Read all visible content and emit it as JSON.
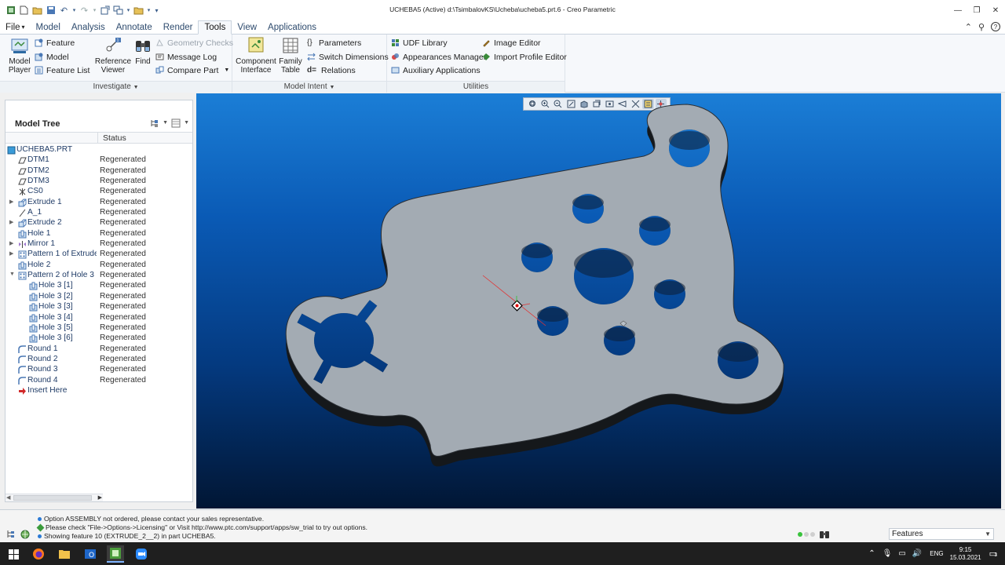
{
  "window": {
    "title": "UCHEBA5 (Active) d:\\TsimbalovKS\\Ucheba\\ucheba5.prt.6 - Creo Parametric"
  },
  "tabs": [
    {
      "label": "File",
      "id": "file"
    },
    {
      "label": "Model",
      "id": "model"
    },
    {
      "label": "Analysis",
      "id": "analysis"
    },
    {
      "label": "Annotate",
      "id": "annotate"
    },
    {
      "label": "Render",
      "id": "render"
    },
    {
      "label": "Tools",
      "id": "tools",
      "active": true
    },
    {
      "label": "View",
      "id": "view"
    },
    {
      "label": "Applications",
      "id": "applications"
    }
  ],
  "ribbon": {
    "investigate": {
      "label": "Investigate",
      "model_player": "Model\nPlayer",
      "feature": "Feature",
      "model": "Model",
      "feature_list": "Feature List",
      "reference_viewer": "Reference\nViewer",
      "find": "Find",
      "geometry_checks": "Geometry Checks",
      "message_log": "Message Log",
      "compare_part": "Compare Part"
    },
    "model_intent": {
      "label": "Model Intent",
      "component_interface": "Component\nInterface",
      "family_table": "Family\nTable",
      "parameters": "Parameters",
      "switch_dimensions": "Switch Dimensions",
      "relations": "Relations"
    },
    "utilities": {
      "label": "Utilities",
      "udf_library": "UDF Library",
      "appearances_manager": "Appearances Manager",
      "auxiliary_applications": "Auxiliary Applications",
      "image_editor": "Image Editor",
      "import_profile_editor": "Import Profile Editor"
    }
  },
  "model_tree": {
    "title": "Model Tree",
    "status_header": "Status",
    "rows": [
      {
        "name": "UCHEBA5.PRT",
        "status": "",
        "level": 0,
        "icon": "part",
        "expander": ""
      },
      {
        "name": "DTM1",
        "status": "Regenerated",
        "level": 1,
        "icon": "plane",
        "expander": ""
      },
      {
        "name": "DTM2",
        "status": "Regenerated",
        "level": 1,
        "icon": "plane",
        "expander": ""
      },
      {
        "name": "DTM3",
        "status": "Regenerated",
        "level": 1,
        "icon": "plane",
        "expander": ""
      },
      {
        "name": "CS0",
        "status": "Regenerated",
        "level": 1,
        "icon": "csys",
        "expander": ""
      },
      {
        "name": "Extrude 1",
        "status": "Regenerated",
        "level": 1,
        "icon": "extrude",
        "expander": "▶"
      },
      {
        "name": "A_1",
        "status": "Regenerated",
        "level": 1,
        "icon": "axis",
        "expander": ""
      },
      {
        "name": "Extrude 2",
        "status": "Regenerated",
        "level": 1,
        "icon": "extrude",
        "expander": "▶"
      },
      {
        "name": "Hole 1",
        "status": "Regenerated",
        "level": 1,
        "icon": "hole",
        "expander": ""
      },
      {
        "name": "Mirror 1",
        "status": "Regenerated",
        "level": 1,
        "icon": "mirror",
        "expander": "▶"
      },
      {
        "name": "Pattern 1 of Extrude 2",
        "status": "Regenerated",
        "level": 1,
        "icon": "pattern",
        "expander": "▶"
      },
      {
        "name": "Hole 2",
        "status": "Regenerated",
        "level": 1,
        "icon": "hole",
        "expander": ""
      },
      {
        "name": "Pattern 2 of Hole 3",
        "status": "Regenerated",
        "level": 1,
        "icon": "pattern",
        "expander": "▼"
      },
      {
        "name": "Hole 3 [1]",
        "status": "Regenerated",
        "level": 2,
        "icon": "hole",
        "expander": ""
      },
      {
        "name": "Hole 3 [2]",
        "status": "Regenerated",
        "level": 2,
        "icon": "hole",
        "expander": ""
      },
      {
        "name": "Hole 3 [3]",
        "status": "Regenerated",
        "level": 2,
        "icon": "hole",
        "expander": ""
      },
      {
        "name": "Hole 3 [4]",
        "status": "Regenerated",
        "level": 2,
        "icon": "hole",
        "expander": ""
      },
      {
        "name": "Hole 3 [5]",
        "status": "Regenerated",
        "level": 2,
        "icon": "hole",
        "expander": ""
      },
      {
        "name": "Hole 3 [6]",
        "status": "Regenerated",
        "level": 2,
        "icon": "hole",
        "expander": ""
      },
      {
        "name": "Round 1",
        "status": "Regenerated",
        "level": 1,
        "icon": "round",
        "expander": ""
      },
      {
        "name": "Round 2",
        "status": "Regenerated",
        "level": 1,
        "icon": "round",
        "expander": ""
      },
      {
        "name": "Round 3",
        "status": "Regenerated",
        "level": 1,
        "icon": "round",
        "expander": ""
      },
      {
        "name": "Round 4",
        "status": "Regenerated",
        "level": 1,
        "icon": "round",
        "expander": ""
      },
      {
        "name": "Insert Here",
        "status": "",
        "level": 1,
        "icon": "insert",
        "expander": ""
      }
    ]
  },
  "messages": [
    "Option ASSEMBLY not ordered, please contact your sales representative.",
    "Please check \"File->Options->Licensing\" or Visit http://www.ptc.com/support/apps/sw_trial to try out options.",
    "Showing feature 10 (EXTRUDE_2__2) in part UCHEBA5."
  ],
  "selection_filter": "Features",
  "taskbar": {
    "lang": "ENG",
    "time": "9:15",
    "date": "15.03.2021",
    "notif_count": "3"
  },
  "colors": {
    "part_face": "#9ea6ae",
    "part_edge": "#1c1f22",
    "background_top": "#1b7ed6",
    "background_bottom": "#011634",
    "accent": "#2d4a6d"
  }
}
